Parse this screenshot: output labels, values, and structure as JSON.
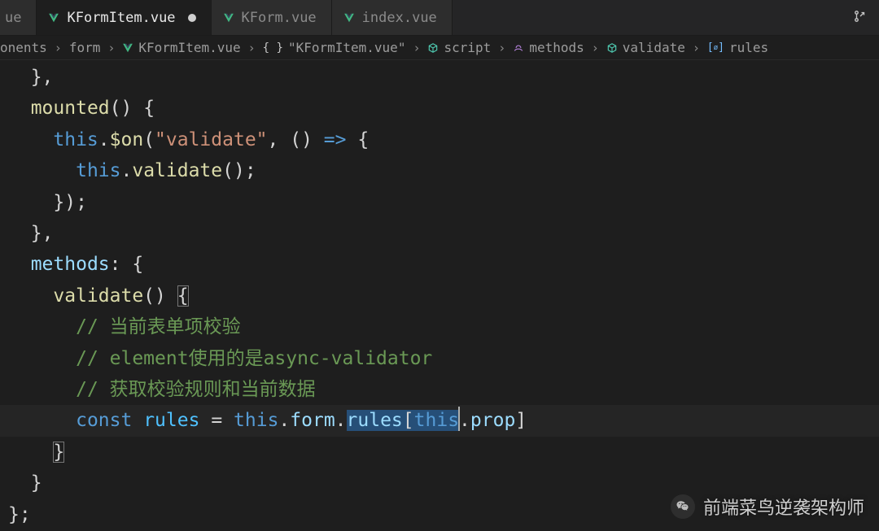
{
  "tabs": [
    {
      "label": "ue",
      "icon": "vue-file-icon",
      "active": false,
      "dirty": false,
      "partial": true
    },
    {
      "label": "KFormItem.vue",
      "icon": "vue-file-icon",
      "active": true,
      "dirty": true
    },
    {
      "label": "KForm.vue",
      "icon": "vue-file-icon",
      "active": false,
      "dirty": false
    },
    {
      "label": "index.vue",
      "icon": "vue-file-icon",
      "active": false,
      "dirty": false
    }
  ],
  "breadcrumbs": [
    {
      "label": "onents",
      "icon": null
    },
    {
      "label": "form",
      "icon": null
    },
    {
      "label": "KFormItem.vue",
      "icon": "vue-file-icon"
    },
    {
      "label": "\"KFormItem.vue\"",
      "icon": "symbol-namespace-icon"
    },
    {
      "label": "script",
      "icon": "symbol-module-icon"
    },
    {
      "label": "methods",
      "icon": "symbol-method-icon"
    },
    {
      "label": "validate",
      "icon": "symbol-module-icon"
    },
    {
      "label": "rules",
      "icon": "symbol-constant-icon"
    }
  ],
  "code": {
    "lines": [
      "  },",
      "  mounted() {",
      "    this.$on(\"validate\", () => {",
      "      this.validate();",
      "    });",
      "  },",
      "  methods: {",
      "    validate() {",
      "      // 当前表单项校验",
      "      // element使用的是async-validator",
      "      // 获取校验规则和当前数据",
      "      const rules = this.form.rules[this.prop]",
      "    }",
      "  }",
      "};"
    ],
    "selection": {
      "line": 11,
      "text": "rules[this"
    },
    "cursor_line": 11
  },
  "watermark": "前端菜鸟逆袭架构师"
}
